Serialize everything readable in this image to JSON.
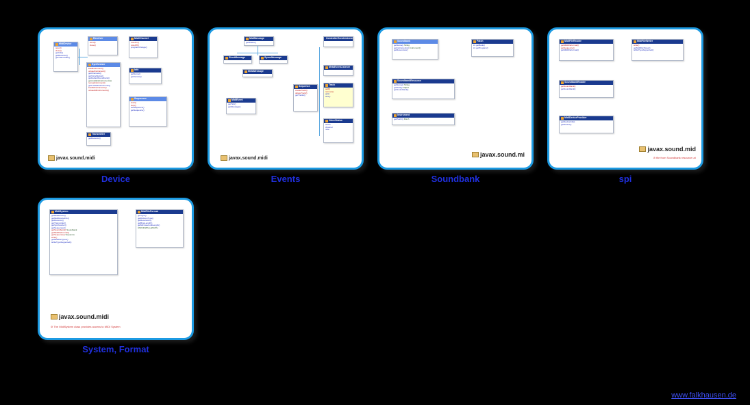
{
  "cards": [
    {
      "caption": "Device",
      "package": "javax.sound.midi",
      "classes": [
        "MidiDevice",
        "Receiver",
        "Transmitter",
        "Synthesizer",
        "Sequencer",
        "MidiChannel",
        "Info"
      ]
    },
    {
      "caption": "Events",
      "package": "javax.sound.midi",
      "classes": [
        "MidiMessage",
        "ShortMessage",
        "SysexMessage",
        "MetaMessage",
        "MidiEvent",
        "Sequence",
        "Track",
        "ControllerEventListener",
        "MetaEventListener"
      ]
    },
    {
      "caption": "Soundbank",
      "package": "javax.sound.mi",
      "classes": [
        "Soundbank",
        "Patch",
        "SoundbankResource",
        "Instrument"
      ]
    },
    {
      "caption": "spi",
      "package": "javax.sound.mid",
      "classes": [
        "MidiFileReader",
        "MidiFileWriter",
        "SoundbankReader",
        "MidiDeviceProvider"
      ]
    },
    {
      "caption": "System, Format",
      "package": "javax.sound.midi",
      "classes": [
        "MidiSystem",
        "MidiFileFormat"
      ]
    }
  ],
  "footer": "www.falkhausen.de"
}
